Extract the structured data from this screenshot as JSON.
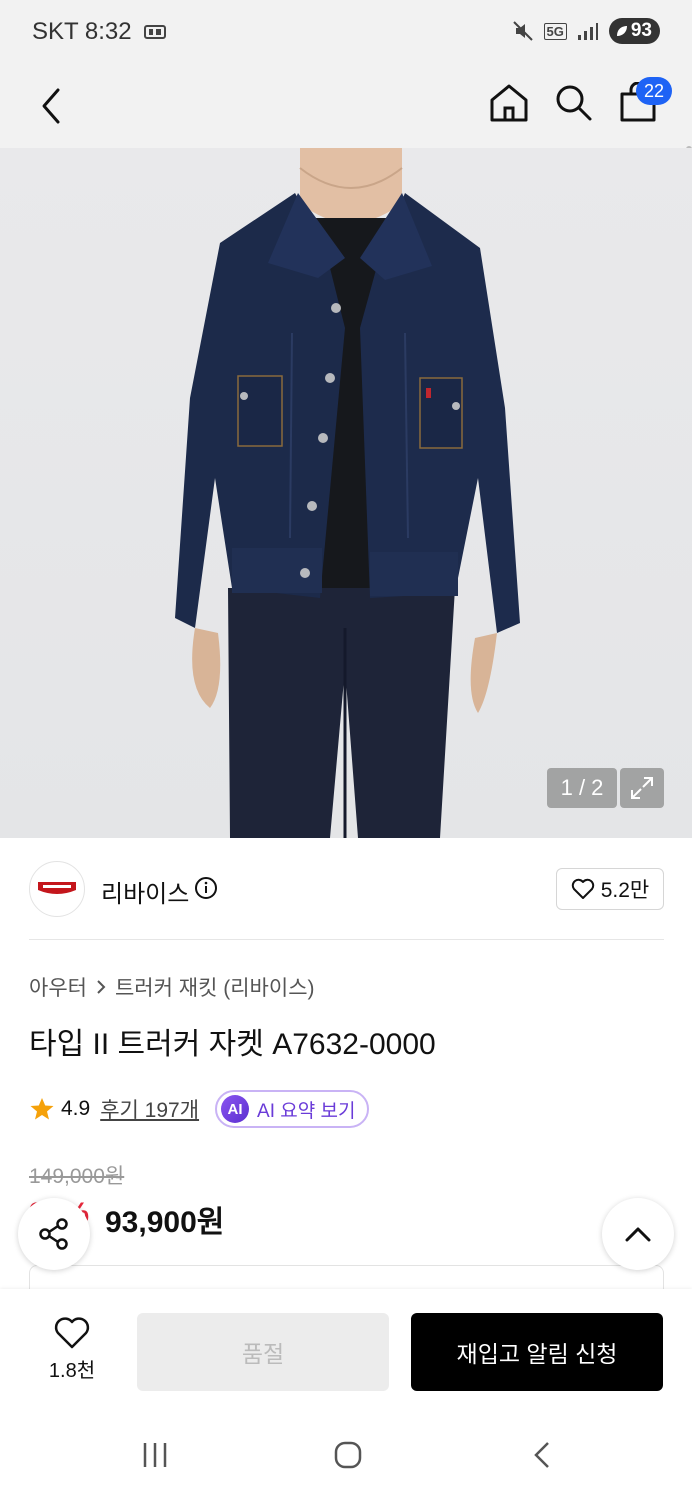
{
  "status": {
    "carrier_time": "SKT 8:32",
    "network": "5G",
    "battery": "93"
  },
  "nav": {
    "bag_count": "22"
  },
  "gallery": {
    "counter": "1 / 2"
  },
  "brand": {
    "name": "리바이스",
    "likes": "5.2만"
  },
  "breadcrumb": {
    "category": "아우터",
    "subcategory": "트러커 재킷 (리바이스)"
  },
  "product": {
    "title": "타입 II 트러커 자켓 A7632-0000",
    "rating": "4.9",
    "reviews": "후기 197개",
    "ai_badge": "AI",
    "ai_summary": "AI 요약 보기",
    "original_price": "149,000원",
    "discount": "37%",
    "sale_price": "93,900원"
  },
  "actions": {
    "wish_count": "1.8천",
    "soldout_label": "품절",
    "restock_label": "재입고 알림 신청"
  },
  "colors": {
    "accent_blue": "#1e63f5",
    "discount_red": "#e5273b",
    "ai_purple": "#6a3bd8",
    "denim": "#1c2a4a"
  }
}
